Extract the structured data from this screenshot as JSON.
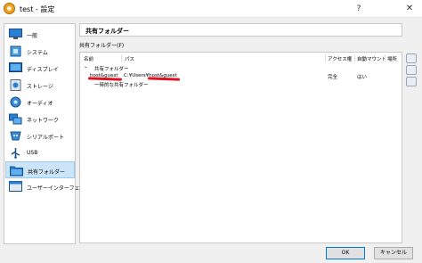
{
  "window": {
    "title": "test - 設定",
    "help_label": "?",
    "close_label": "✕"
  },
  "sidebar": {
    "items": [
      {
        "label": "一般",
        "icon": "monitor-icon"
      },
      {
        "label": "システム",
        "icon": "chip-icon"
      },
      {
        "label": "ディスプレイ",
        "icon": "display-icon"
      },
      {
        "label": "ストレージ",
        "icon": "storage-icon"
      },
      {
        "label": "オーディオ",
        "icon": "speaker-icon"
      },
      {
        "label": "ネットワーク",
        "icon": "network-icon"
      },
      {
        "label": "シリアルポート",
        "icon": "serial-port-icon"
      },
      {
        "label": "USB",
        "icon": "usb-icon"
      },
      {
        "label": "共有フォルダー",
        "icon": "shared-folder-icon"
      },
      {
        "label": "ユーザーインターフェース",
        "icon": "ui-window-icon"
      }
    ],
    "selected_index": 8
  },
  "main": {
    "page_title": "共有フォルダー",
    "group_label": "共有フォルダー(F)",
    "columns": {
      "name": "名前",
      "path": "パス",
      "access": "アクセス権",
      "automount": "自動マウント",
      "location": "場所"
    },
    "tree": {
      "machine_folders_label": "共有フォルダー",
      "rows": [
        {
          "name": "host&guest",
          "path": "C:¥Users¥host&guest",
          "access": "完全",
          "automount": "はい"
        }
      ],
      "transient_folders_label": "一時的な共有フォルダー"
    }
  },
  "buttons": {
    "ok": "OK",
    "cancel": "キャンセル"
  },
  "colors": {
    "selection": "#cce4f7",
    "annotation": "#e01020"
  }
}
